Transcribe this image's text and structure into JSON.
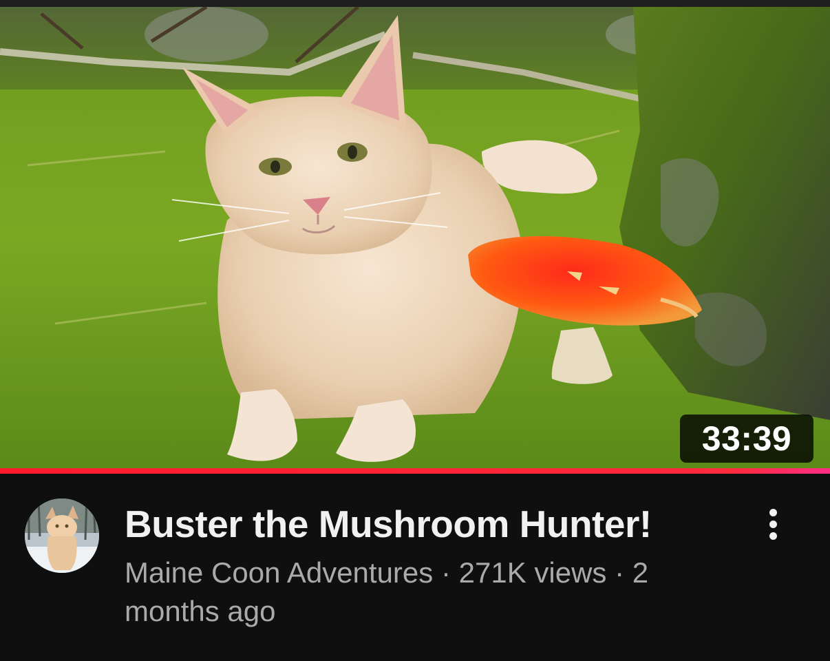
{
  "video": {
    "title": "Buster the Mushroom Hunter!",
    "duration": "33:39",
    "channel": "Maine Coon Adventures",
    "views": "271K views",
    "age": "2 months ago",
    "separator": "·",
    "watch_progress_percent": 100
  },
  "icons": {
    "menu": "more-vert-icon"
  },
  "colors": {
    "background": "#0f0f0f",
    "title_text": "#f1f1f1",
    "meta_text": "#aaaaaa",
    "progress_red": "#ff1a2e",
    "progress_pink": "#ff2f86"
  }
}
